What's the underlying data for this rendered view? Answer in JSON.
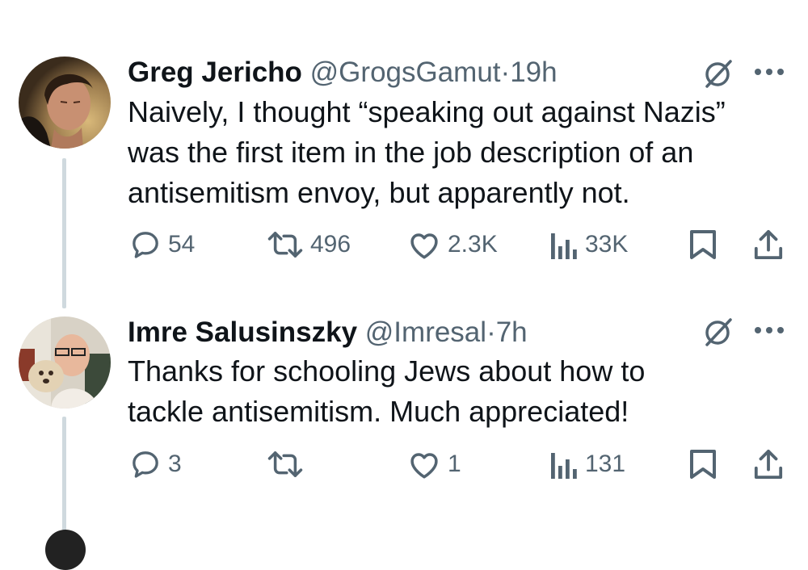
{
  "tweets": [
    {
      "name": "Greg Jericho",
      "handle": "@GrogsGamut",
      "sep": "·",
      "time": "19h",
      "lines": [
        "Naively, I thought “speaking out against Nazis”",
        "was the first item in the job description of an",
        "antisemitism envoy, but apparently not."
      ],
      "replies": "54",
      "reposts": "496",
      "likes": "2.3K",
      "views": "33K"
    },
    {
      "name": "Imre Salusinszky",
      "handle": "@Imresal",
      "sep": "·",
      "time": "7h",
      "lines": [
        "Thanks for schooling Jews about how to",
        "tackle antisemitism. Much appreciated!"
      ],
      "replies": "3",
      "reposts": "",
      "likes": "1",
      "views": "131"
    }
  ],
  "icons": {
    "reply": "reply-icon",
    "repost": "repost-icon",
    "like": "heart-icon",
    "views": "views-icon",
    "bookmark": "bookmark-icon",
    "share": "share-icon",
    "grok": "grok-icon",
    "more": "more-icon"
  },
  "colors": {
    "text": "#0f1419",
    "secondary": "#536471",
    "thread": "#cfd9de"
  }
}
